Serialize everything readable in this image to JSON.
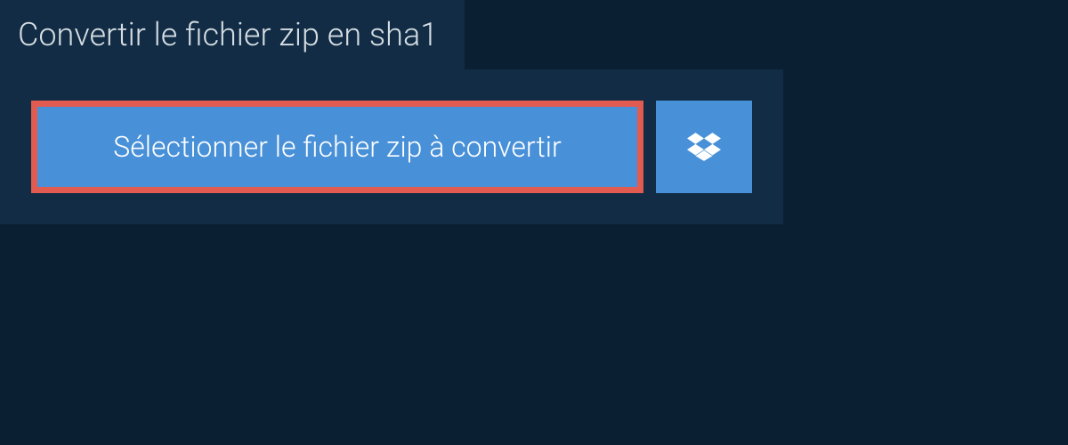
{
  "header": {
    "title": "Convertir le fichier zip en sha1"
  },
  "buttons": {
    "select_file_label": "Sélectionner le fichier zip à convertir"
  },
  "colors": {
    "background": "#0b1f33",
    "panel": "#112c44",
    "button_primary": "#4890d8",
    "highlight_border": "#e15b51",
    "text_light": "#d5dde3",
    "text_white": "#ffffff"
  },
  "icons": {
    "dropbox": "dropbox-icon"
  }
}
